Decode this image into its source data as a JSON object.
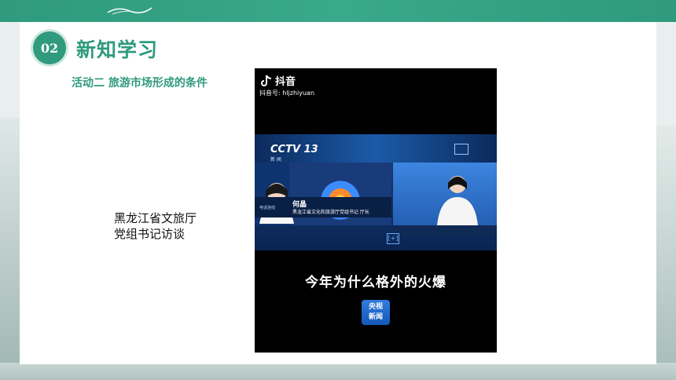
{
  "header": {
    "section_number": "02",
    "section_title": "新知学习",
    "activity_label": "活动二  旅游市场形成的条件"
  },
  "side_note": {
    "line1": "黑龙江省文旅厅",
    "line2": "党组书记访谈"
  },
  "video": {
    "app_name": "抖音",
    "account_id": "抖音号: hljzhiyuan",
    "channel_logo": "CCTV 13",
    "channel_sub": "新 闻",
    "phone_tag": "电话连线",
    "guest_name": "何晶",
    "guest_title": "黑龙江省文化和旅游厅党组书记 厅长",
    "subtitle": "今年为什么格外的火爆",
    "badge_line1": "央视",
    "badge_line2": "新闻",
    "bottom_mark": "[+]"
  },
  "colors": {
    "accent": "#2f9a7d",
    "panel": "#ffffff",
    "news_blue": "#123e7a"
  }
}
